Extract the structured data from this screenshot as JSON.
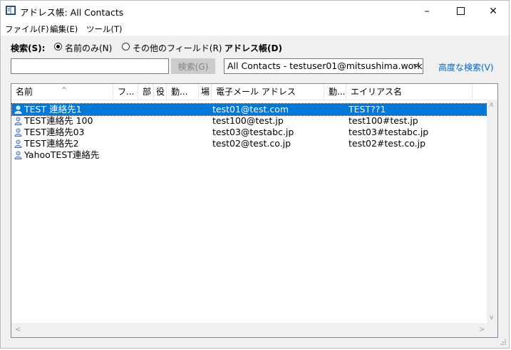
{
  "window": {
    "title": "アドレス帳: All Contacts",
    "minimize_icon": "minimize-icon",
    "maximize_icon": "maximize-icon",
    "close_icon": "close-icon"
  },
  "menu": [
    "ファイル(F)",
    "編集(E)",
    "ツール(T)"
  ],
  "search": {
    "label": "検索(S):",
    "option_name_only": "名前のみ(N)",
    "option_other_fields": "その他のフィールド(R)",
    "selected_option": "名前のみ(N)",
    "input_value": "",
    "button_label": "検索(G)"
  },
  "address_book": {
    "label": "アドレス帳(D)",
    "selected": "All Contacts - testuser01@mitsushima.work",
    "advanced_link": "高度な検索(V)"
  },
  "columns": [
    "名前",
    "フ...",
    "部",
    "役",
    "勤...",
    "場",
    "電子メール アドレス",
    "勤...",
    "エイリアス名"
  ],
  "contacts": [
    {
      "name": "TEST 連絡先1",
      "email": "test01@test.com",
      "alias": "TEST??1",
      "selected": true
    },
    {
      "name": "TEST連絡先 100",
      "email": "test100@test.jp",
      "alias": "test100#test.jp",
      "selected": false
    },
    {
      "name": "TEST連絡先03",
      "email": "test03@testabc.jp",
      "alias": "test03#testabc.jp",
      "selected": false
    },
    {
      "name": "TEST連絡先2",
      "email": "test02@test.co.jp",
      "alias": "test02#test.co.jp",
      "selected": false
    },
    {
      "name": "YahooTEST連絡先",
      "email": "",
      "alias": "",
      "selected": false
    }
  ],
  "colors": {
    "selection": "#0078d7",
    "link": "#0066cc"
  }
}
